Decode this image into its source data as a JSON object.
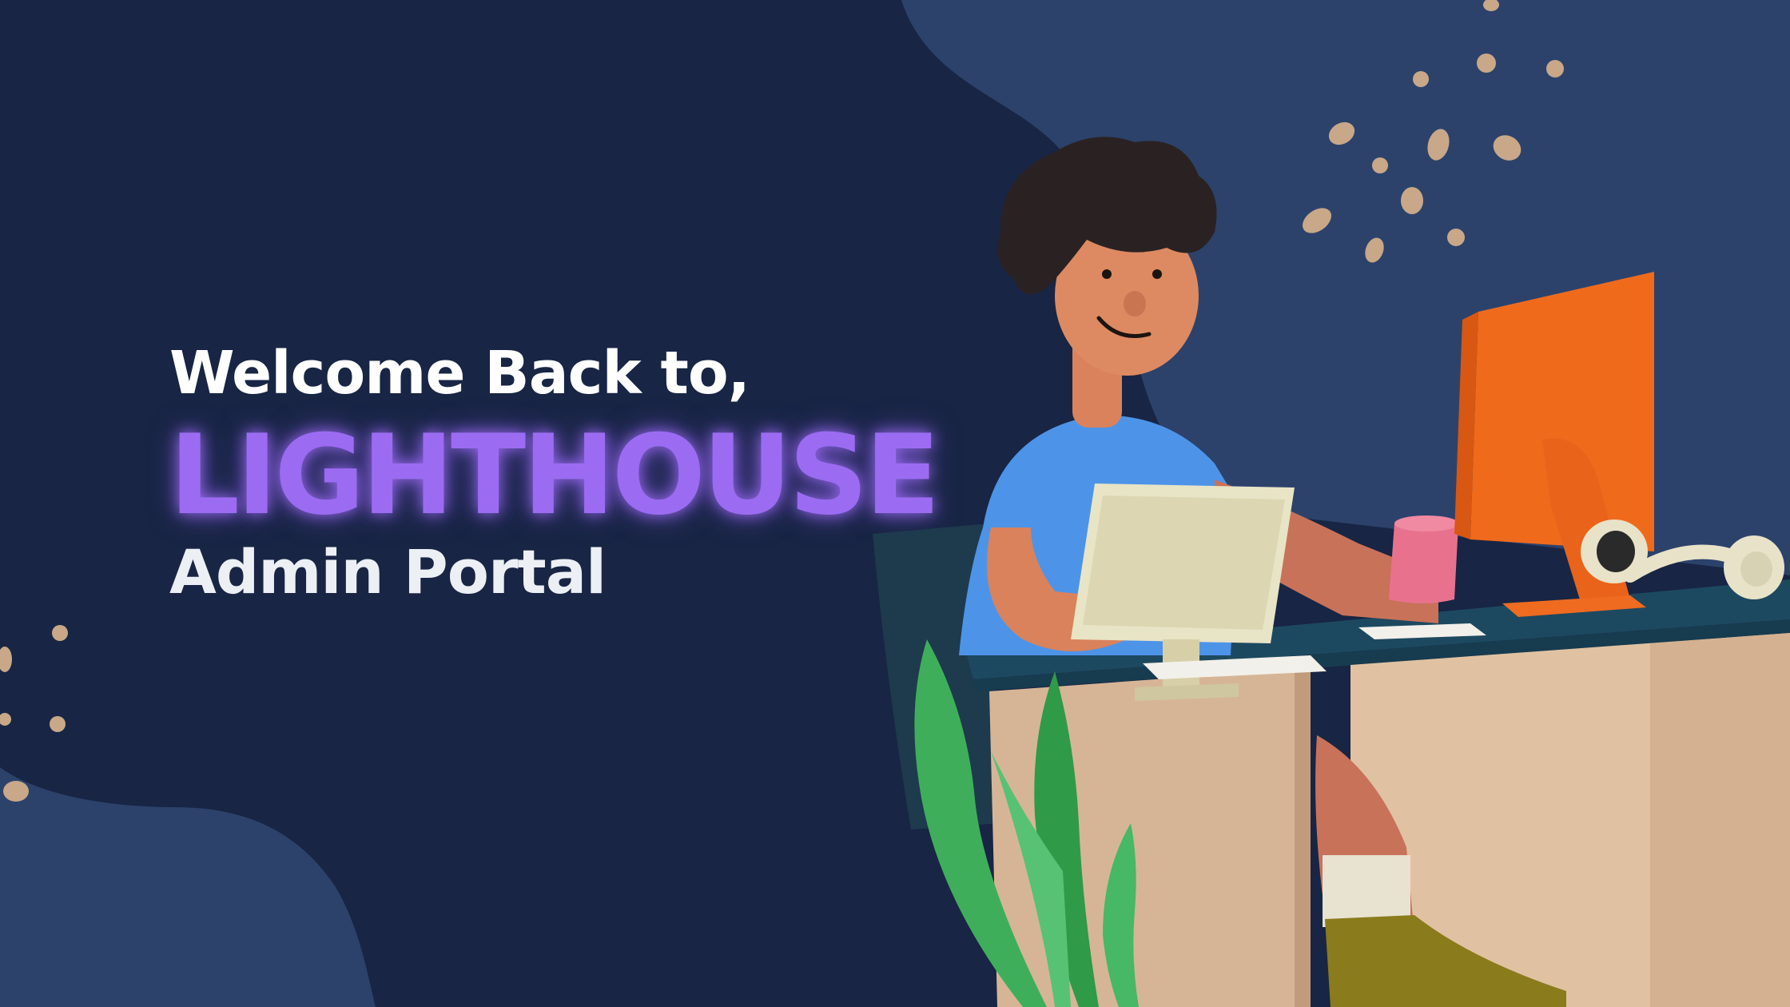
{
  "hero": {
    "welcome_text": "Welcome Back to,",
    "brand_name": "LIGHTHOUSE",
    "subtitle": "Admin Portal"
  },
  "colors": {
    "background": "#182544",
    "blob": "#2c426b",
    "accent": "#9b6cf2",
    "dots": "#c8a888"
  },
  "illustration": {
    "icon": "person-at-desk-illustration"
  }
}
